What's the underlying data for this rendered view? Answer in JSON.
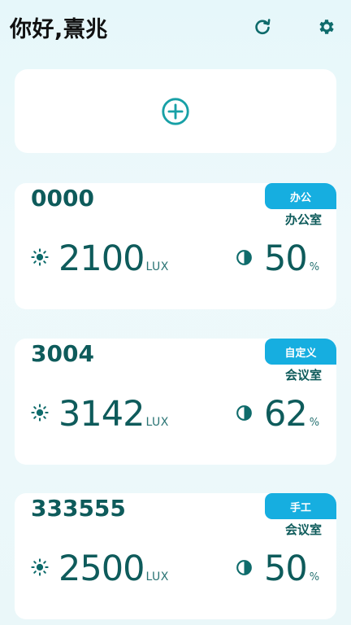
{
  "header": {
    "greeting": "你好,熹兆",
    "refresh_icon": "refresh-icon",
    "settings_icon": "gear-icon"
  },
  "add_card": {
    "icon": "plus-circle-icon"
  },
  "colors": {
    "accent": "#16aee0",
    "text_primary": "#0e5b5b",
    "icon_teal": "#17a0a6"
  },
  "devices": [
    {
      "id": "0000",
      "tag": "办公",
      "room": "办公室",
      "lux": "2100",
      "lux_unit": "LUX",
      "percent": "50",
      "percent_unit": "%"
    },
    {
      "id": "3004",
      "tag": "自定义",
      "room": "会议室",
      "lux": "3142",
      "lux_unit": "LUX",
      "percent": "62",
      "percent_unit": "%"
    },
    {
      "id": "333555",
      "tag": "手工",
      "room": "会议室",
      "lux": "2500",
      "lux_unit": "LUX",
      "percent": "50",
      "percent_unit": "%"
    }
  ]
}
